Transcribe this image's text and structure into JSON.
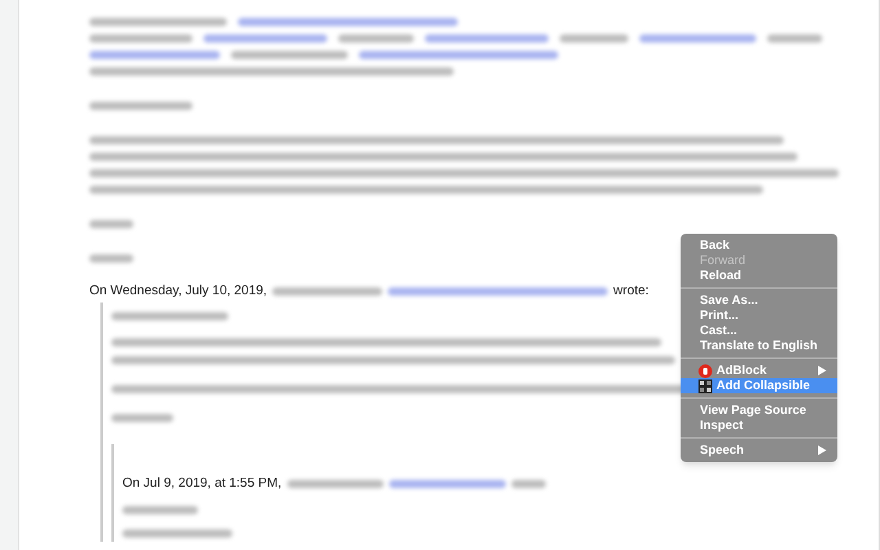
{
  "email": {
    "quote_header": "On Wednesday, July 10, 2019,",
    "quote_suffix": "wrote:",
    "nested_quote_header": "On Jul 9, 2019, at 1:55 PM,"
  },
  "context_menu": {
    "items": [
      {
        "kind": "item",
        "label": "Back",
        "disabled": false,
        "selected": false
      },
      {
        "kind": "item",
        "label": "Forward",
        "disabled": true,
        "selected": false
      },
      {
        "kind": "item",
        "label": "Reload",
        "disabled": false,
        "selected": false
      },
      {
        "kind": "separator"
      },
      {
        "kind": "item",
        "label": "Save As...",
        "disabled": false,
        "selected": false
      },
      {
        "kind": "item",
        "label": "Print...",
        "disabled": false,
        "selected": false
      },
      {
        "kind": "item",
        "label": "Cast...",
        "disabled": false,
        "selected": false
      },
      {
        "kind": "item",
        "label": "Translate to English",
        "disabled": false,
        "selected": false
      },
      {
        "kind": "separator"
      },
      {
        "kind": "hand",
        "label": "AdBlock",
        "disabled": false,
        "selected": false,
        "submenu": true
      },
      {
        "kind": "grid",
        "label": "Add Collapsible",
        "disabled": false,
        "selected": true
      },
      {
        "kind": "separator"
      },
      {
        "kind": "item",
        "label": "View Page Source",
        "disabled": false,
        "selected": false
      },
      {
        "kind": "item",
        "label": "Inspect",
        "disabled": false,
        "selected": false
      },
      {
        "kind": "separator"
      },
      {
        "kind": "item",
        "label": "Speech",
        "disabled": false,
        "selected": false,
        "submenu": true
      }
    ]
  }
}
